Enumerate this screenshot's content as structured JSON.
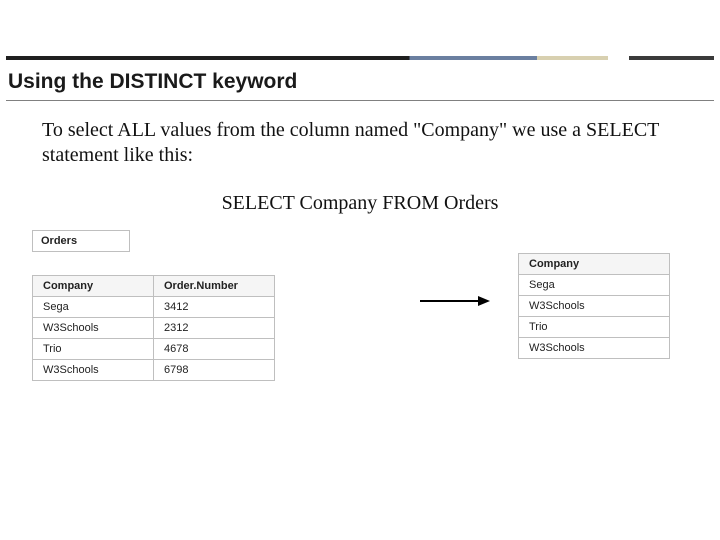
{
  "title": "Using the DISTINCT keyword",
  "body": "To select ALL values from the column named \"Company\" we use a SELECT statement like this:",
  "sql": "SELECT Company FROM Orders",
  "ordersLabel": "Orders",
  "ordersTable": {
    "headers": [
      "Company",
      "Order.Number"
    ],
    "rows": [
      [
        "Sega",
        "3412"
      ],
      [
        "W3Schools",
        "2312"
      ],
      [
        "Trio",
        "4678"
      ],
      [
        "W3Schools",
        "6798"
      ]
    ]
  },
  "resultTable": {
    "headers": [
      "Company"
    ],
    "rows": [
      [
        "Sega"
      ],
      [
        "W3Schools"
      ],
      [
        "Trio"
      ],
      [
        "W3Schools"
      ]
    ]
  }
}
